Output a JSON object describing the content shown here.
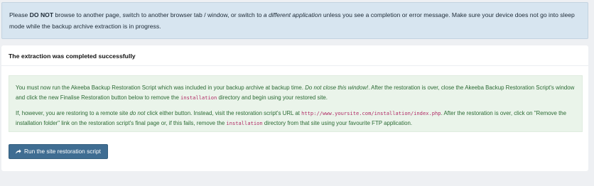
{
  "notice": {
    "part1": "Please ",
    "strong": "DO NOT",
    "part2": " browse to another page, switch to another browser tab / window, or switch to ",
    "em": "a different application",
    "part3": " unless you see a completion or error message. Make sure your device does not go into sleep mode while the backup archive extraction is in progress."
  },
  "card": {
    "title": "The extraction was completed successfully"
  },
  "success": {
    "p1": {
      "part1": "You must now run the Akeeba Backup Restoration Script which was included in your backup archive at backup time. ",
      "em": "Do not close this window!",
      "part2": ". After the restoration is over, close the Akeeba Backup Restoration Script's window and click the new Finalise Restoration button below to remove the ",
      "code": "installation",
      "part3": " directory and begin using your restored site."
    },
    "p2": {
      "part1": "If, however, you are restoring to a remote site ",
      "em": "do not",
      "part2": " click either button. Instead, visit the restoration script's URL at ",
      "code1": "http://www.yoursite.com/installation/index.php",
      "part3": ". After the restoration is over, click on \"Remove the installation folder\" link on the restoration script's final page or, if this fails, remove the ",
      "code2": "installation",
      "part4": " directory from that site using your favourite FTP application."
    }
  },
  "button": {
    "icon": "external-link-icon",
    "label": "Run the site restoration script"
  }
}
